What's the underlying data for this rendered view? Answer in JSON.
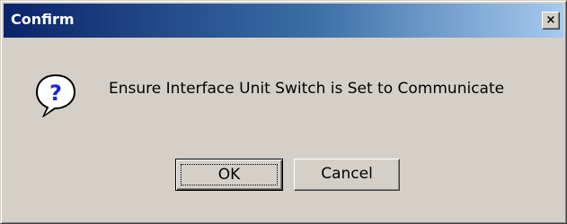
{
  "window": {
    "title": "Confirm",
    "close_glyph": "×",
    "titlebar_colors": [
      "#0a246a",
      "#a6caf0"
    ]
  },
  "icon": {
    "name": "question-icon",
    "glyph": "?"
  },
  "message": "Ensure Interface Unit Switch is Set to Communicate",
  "buttons": {
    "ok_label": "OK",
    "cancel_label": "Cancel"
  }
}
